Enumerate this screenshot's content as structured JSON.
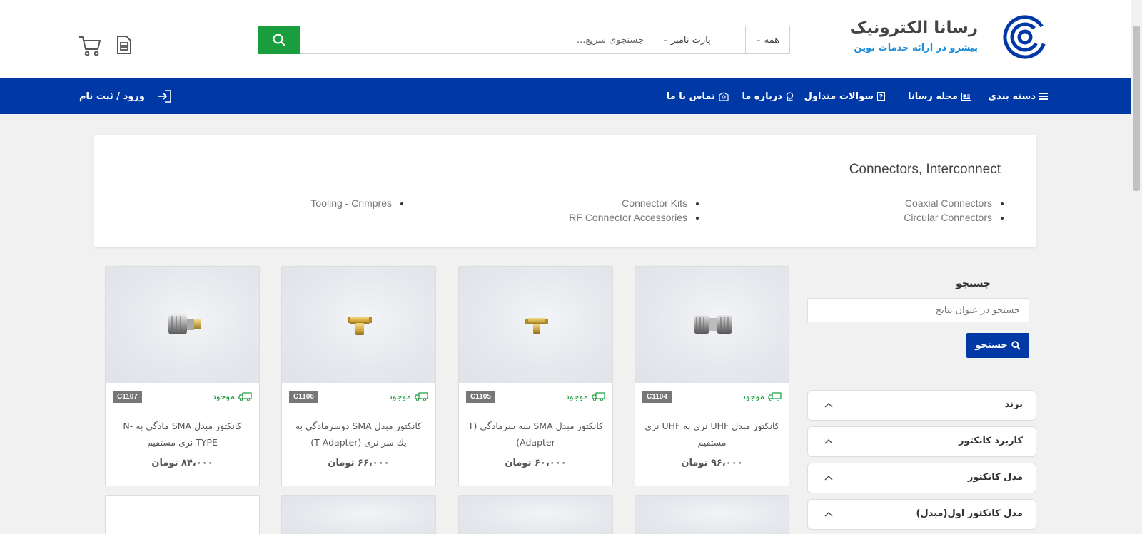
{
  "header": {
    "logo_title": "رسانا الکترونیک",
    "logo_subtitle": "پیشرو در ارائه خدمات نوین",
    "search_placeholder": "جستجوی سریع...",
    "partno_select": "پارت نامبر",
    "scope_select": "همه",
    "icons": [
      "search-icon",
      "document-icon",
      "cart-icon"
    ]
  },
  "nav": {
    "items": [
      {
        "label": "دسته بندی",
        "icon": "menu-icon"
      },
      {
        "label": "مجله رسانا",
        "icon": "newspaper-icon"
      },
      {
        "label": "سوالات متداول",
        "icon": "question-icon"
      },
      {
        "label": "درباره ما",
        "icon": "award-icon"
      },
      {
        "label": "تماس با ما",
        "icon": "contact-icon"
      }
    ],
    "login": "ورود / ثبت نام"
  },
  "category": {
    "title": "Connectors, Interconnect",
    "links": [
      "Coaxial Connectors",
      "Circular Connectors",
      "Connector Kits",
      "RF Connector Accessories",
      "Tooling - Crimpres"
    ]
  },
  "sidebar": {
    "search_label": "جستجو",
    "search_placeholder": "جستجو در عنوان نتایج",
    "search_button": "جستجو",
    "filters": [
      "برند",
      "کاربرد کانکتور",
      "مدل کانکتور",
      "مدل کانکتور اول(مبدل)"
    ]
  },
  "products": [
    {
      "code": "C1104",
      "stock": "موجود",
      "title": "کانکتور مبدل UHF نری به UHF نری مستقیم",
      "price": "۹۶،۰۰۰ تومان"
    },
    {
      "code": "C1105",
      "stock": "موجود",
      "title": "کانکتور مبدل SMA سه سرمادگی (T Adapter)",
      "price": "۶۰،۰۰۰ تومان"
    },
    {
      "code": "C1106",
      "stock": "موجود",
      "title": "کانکتور مبدل SMA دوسرمادگی به یك سر نری (T Adapter)",
      "price": "۶۶،۰۰۰ تومان"
    },
    {
      "code": "C1107",
      "stock": "موجود",
      "title": "کانکتور مبدل SMA مادگی به N-TYPE نری مستقیم",
      "price": "۸۴،۰۰۰ تومان"
    }
  ],
  "colors": {
    "brand_blue": "#0039a6",
    "green": "#1a9d3c",
    "accent_light_blue": "#1a8ed8"
  }
}
